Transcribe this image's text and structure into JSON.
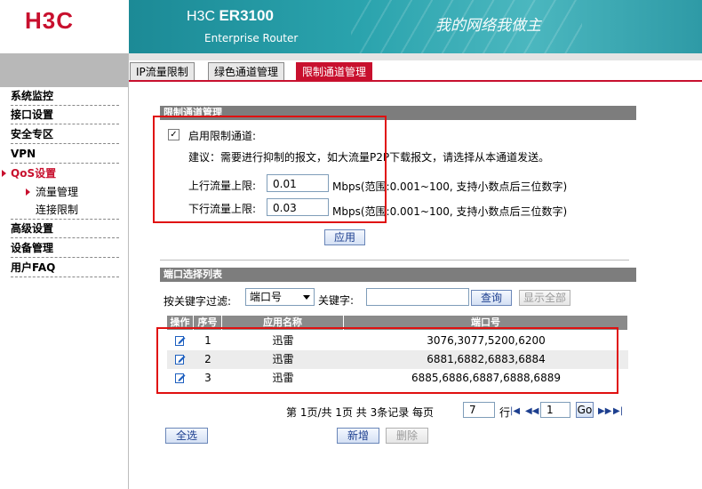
{
  "header": {
    "logo": "H3C",
    "product_brand": "H3C",
    "product_model": "ER3100",
    "product_subtitle": "Enterprise Router",
    "slogan": "我的网络我做主"
  },
  "sidebar": {
    "items": [
      {
        "label": "系统监控"
      },
      {
        "label": "接口设置"
      },
      {
        "label": "安全专区"
      },
      {
        "label": "VPN"
      },
      {
        "label": "QoS设置"
      },
      {
        "label": "高级设置"
      },
      {
        "label": "设备管理"
      },
      {
        "label": "用户FAQ"
      }
    ],
    "subitems": [
      {
        "label": "流量管理"
      },
      {
        "label": "连接限制"
      }
    ]
  },
  "tabs": [
    {
      "label": "IP流量限制"
    },
    {
      "label": "绿色通道管理"
    },
    {
      "label": "限制通道管理"
    }
  ],
  "limit_section": {
    "title": "限制通道管理",
    "enable_label": "启用限制通道:",
    "enabled": true,
    "advice": "建议：需要进行抑制的报文，如大流量P2P下载报文，请选择从本通道发送。",
    "up_label": "上行流量上限:",
    "up_value": "0.01",
    "down_label": "下行流量上限:",
    "down_value": "0.03",
    "unit_hint": "Mbps(范围:0.001~100, 支持小数点后三位数字)",
    "apply_label": "应用"
  },
  "port_section": {
    "title": "端口选择列表",
    "filter_label": "按关键字过滤:",
    "filter_select": "端口号",
    "keyword_label": "关键字:",
    "keyword_value": "",
    "search_label": "查询",
    "show_all_label": "显示全部",
    "columns": [
      "操作",
      "序号",
      "应用名称",
      "端口号"
    ],
    "rows": [
      {
        "index": "1",
        "app": "迅雷",
        "ports": "3076,3077,5200,6200"
      },
      {
        "index": "2",
        "app": "迅雷",
        "ports": "6881,6882,6883,6884"
      },
      {
        "index": "3",
        "app": "迅雷",
        "ports": "6885,6886,6887,6888,6889"
      }
    ]
  },
  "pager": {
    "summary": "第 1页/共 1页 共 3条记录 每页",
    "per_page": "7",
    "per_page_suffix": "行",
    "page": "1",
    "go_label": "Go"
  },
  "footer": {
    "select_all_label": "全选",
    "add_label": "新增",
    "delete_label": "删除"
  },
  "colors": {
    "accent": "#c8102e",
    "banner": "#2aa3ad",
    "highlight_box": "#e01010"
  }
}
